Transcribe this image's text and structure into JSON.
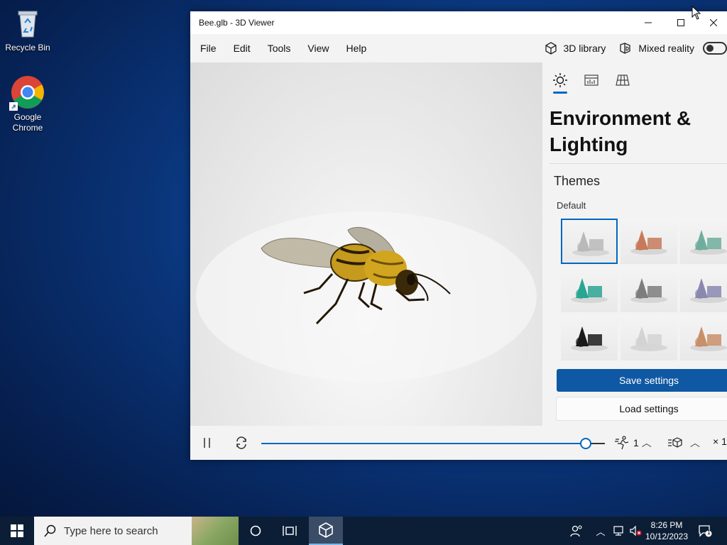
{
  "desktop": {
    "icons": [
      {
        "label": "Recycle Bin"
      },
      {
        "label": "Google Chrome"
      }
    ]
  },
  "window": {
    "title": "Bee.glb - 3D Viewer",
    "menu": [
      "File",
      "Edit",
      "Tools",
      "View",
      "Help"
    ],
    "library_label": "3D library",
    "mixed_reality_label": "Mixed reality",
    "mixed_reality_on": false
  },
  "panel": {
    "tabs": [
      {
        "icon": "sun-icon",
        "active": true
      },
      {
        "icon": "stats-icon",
        "active": false
      },
      {
        "icon": "grid-icon",
        "active": false
      }
    ],
    "title": "Environment & Lighting",
    "themes_heading": "Themes",
    "default_label": "Default",
    "theme_colors": [
      [
        "#b9b9b9",
        "#c77a5a",
        "#6fae9e"
      ],
      [
        "#2aa593",
        "#7d7d7d",
        "#8a88b0"
      ],
      [
        "#1a1a1a",
        "#d3d3d3",
        "#c98f6a"
      ]
    ],
    "save_label": "Save settings",
    "load_label": "Load settings"
  },
  "bottom_bar": {
    "timeline_progress": 0.94,
    "speed_value": "1",
    "scale_label": "× 1"
  },
  "taskbar": {
    "search_placeholder": "Type here to search",
    "time": "8:26 PM",
    "date": "10/12/2023",
    "notification_count": "1"
  },
  "colors": {
    "accent": "#0067c0",
    "save_button": "#0f58a3",
    "taskbar": "#0c1e36"
  }
}
